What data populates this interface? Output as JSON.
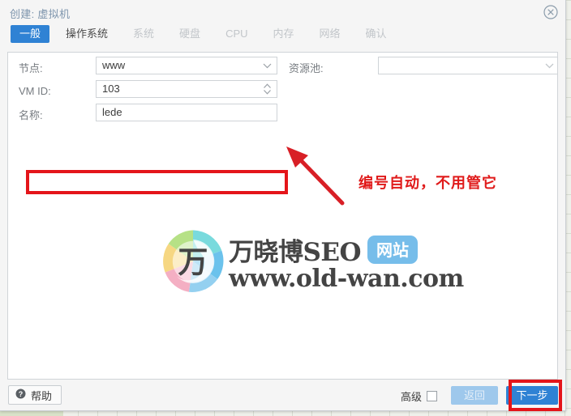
{
  "window": {
    "title": "创建: 虚拟机",
    "close_icon": "close-circle-icon"
  },
  "tabs": [
    {
      "label": "一般",
      "state": "active"
    },
    {
      "label": "操作系统",
      "state": "enabled"
    },
    {
      "label": "系统",
      "state": "disabled"
    },
    {
      "label": "硬盘",
      "state": "disabled"
    },
    {
      "label": "CPU",
      "state": "disabled"
    },
    {
      "label": "内存",
      "state": "disabled"
    },
    {
      "label": "网络",
      "state": "disabled"
    },
    {
      "label": "确认",
      "state": "disabled"
    }
  ],
  "form": {
    "node": {
      "label": "节点:",
      "value": "www",
      "placeholder": "",
      "icon": "chevron-down-icon"
    },
    "vmid": {
      "label": "VM ID:",
      "value": "103",
      "placeholder": "",
      "icon": "spinner-updown-icon"
    },
    "name": {
      "label": "名称:",
      "value": "lede",
      "placeholder": ""
    },
    "pool": {
      "label": "资源池:",
      "value": "",
      "placeholder": "",
      "icon": "chevron-down-icon"
    }
  },
  "annotations": {
    "note_text": "编号自动，不用管它",
    "color": "#e4151a",
    "arrow_icon": "arrow-up-left-icon",
    "highlight_name_field": true,
    "highlight_next_button": true
  },
  "watermark": {
    "brand": "万晓博SEO",
    "badge": "网站",
    "url": "www.old-wan.com",
    "logo_icon": "wan-swirl-logo-icon"
  },
  "footer": {
    "help": {
      "label": "帮助",
      "icon": "question-circle-icon"
    },
    "advanced": {
      "label": "高级",
      "checked": false
    },
    "back": {
      "label": "返回",
      "disabled": true
    },
    "next": {
      "label": "下一步",
      "primary": true
    }
  },
  "colors": {
    "accent": "#2f82d4",
    "annotation_red": "#e4151a",
    "title_blue": "#7e95ad",
    "badge_blue": "#64b5e8"
  }
}
